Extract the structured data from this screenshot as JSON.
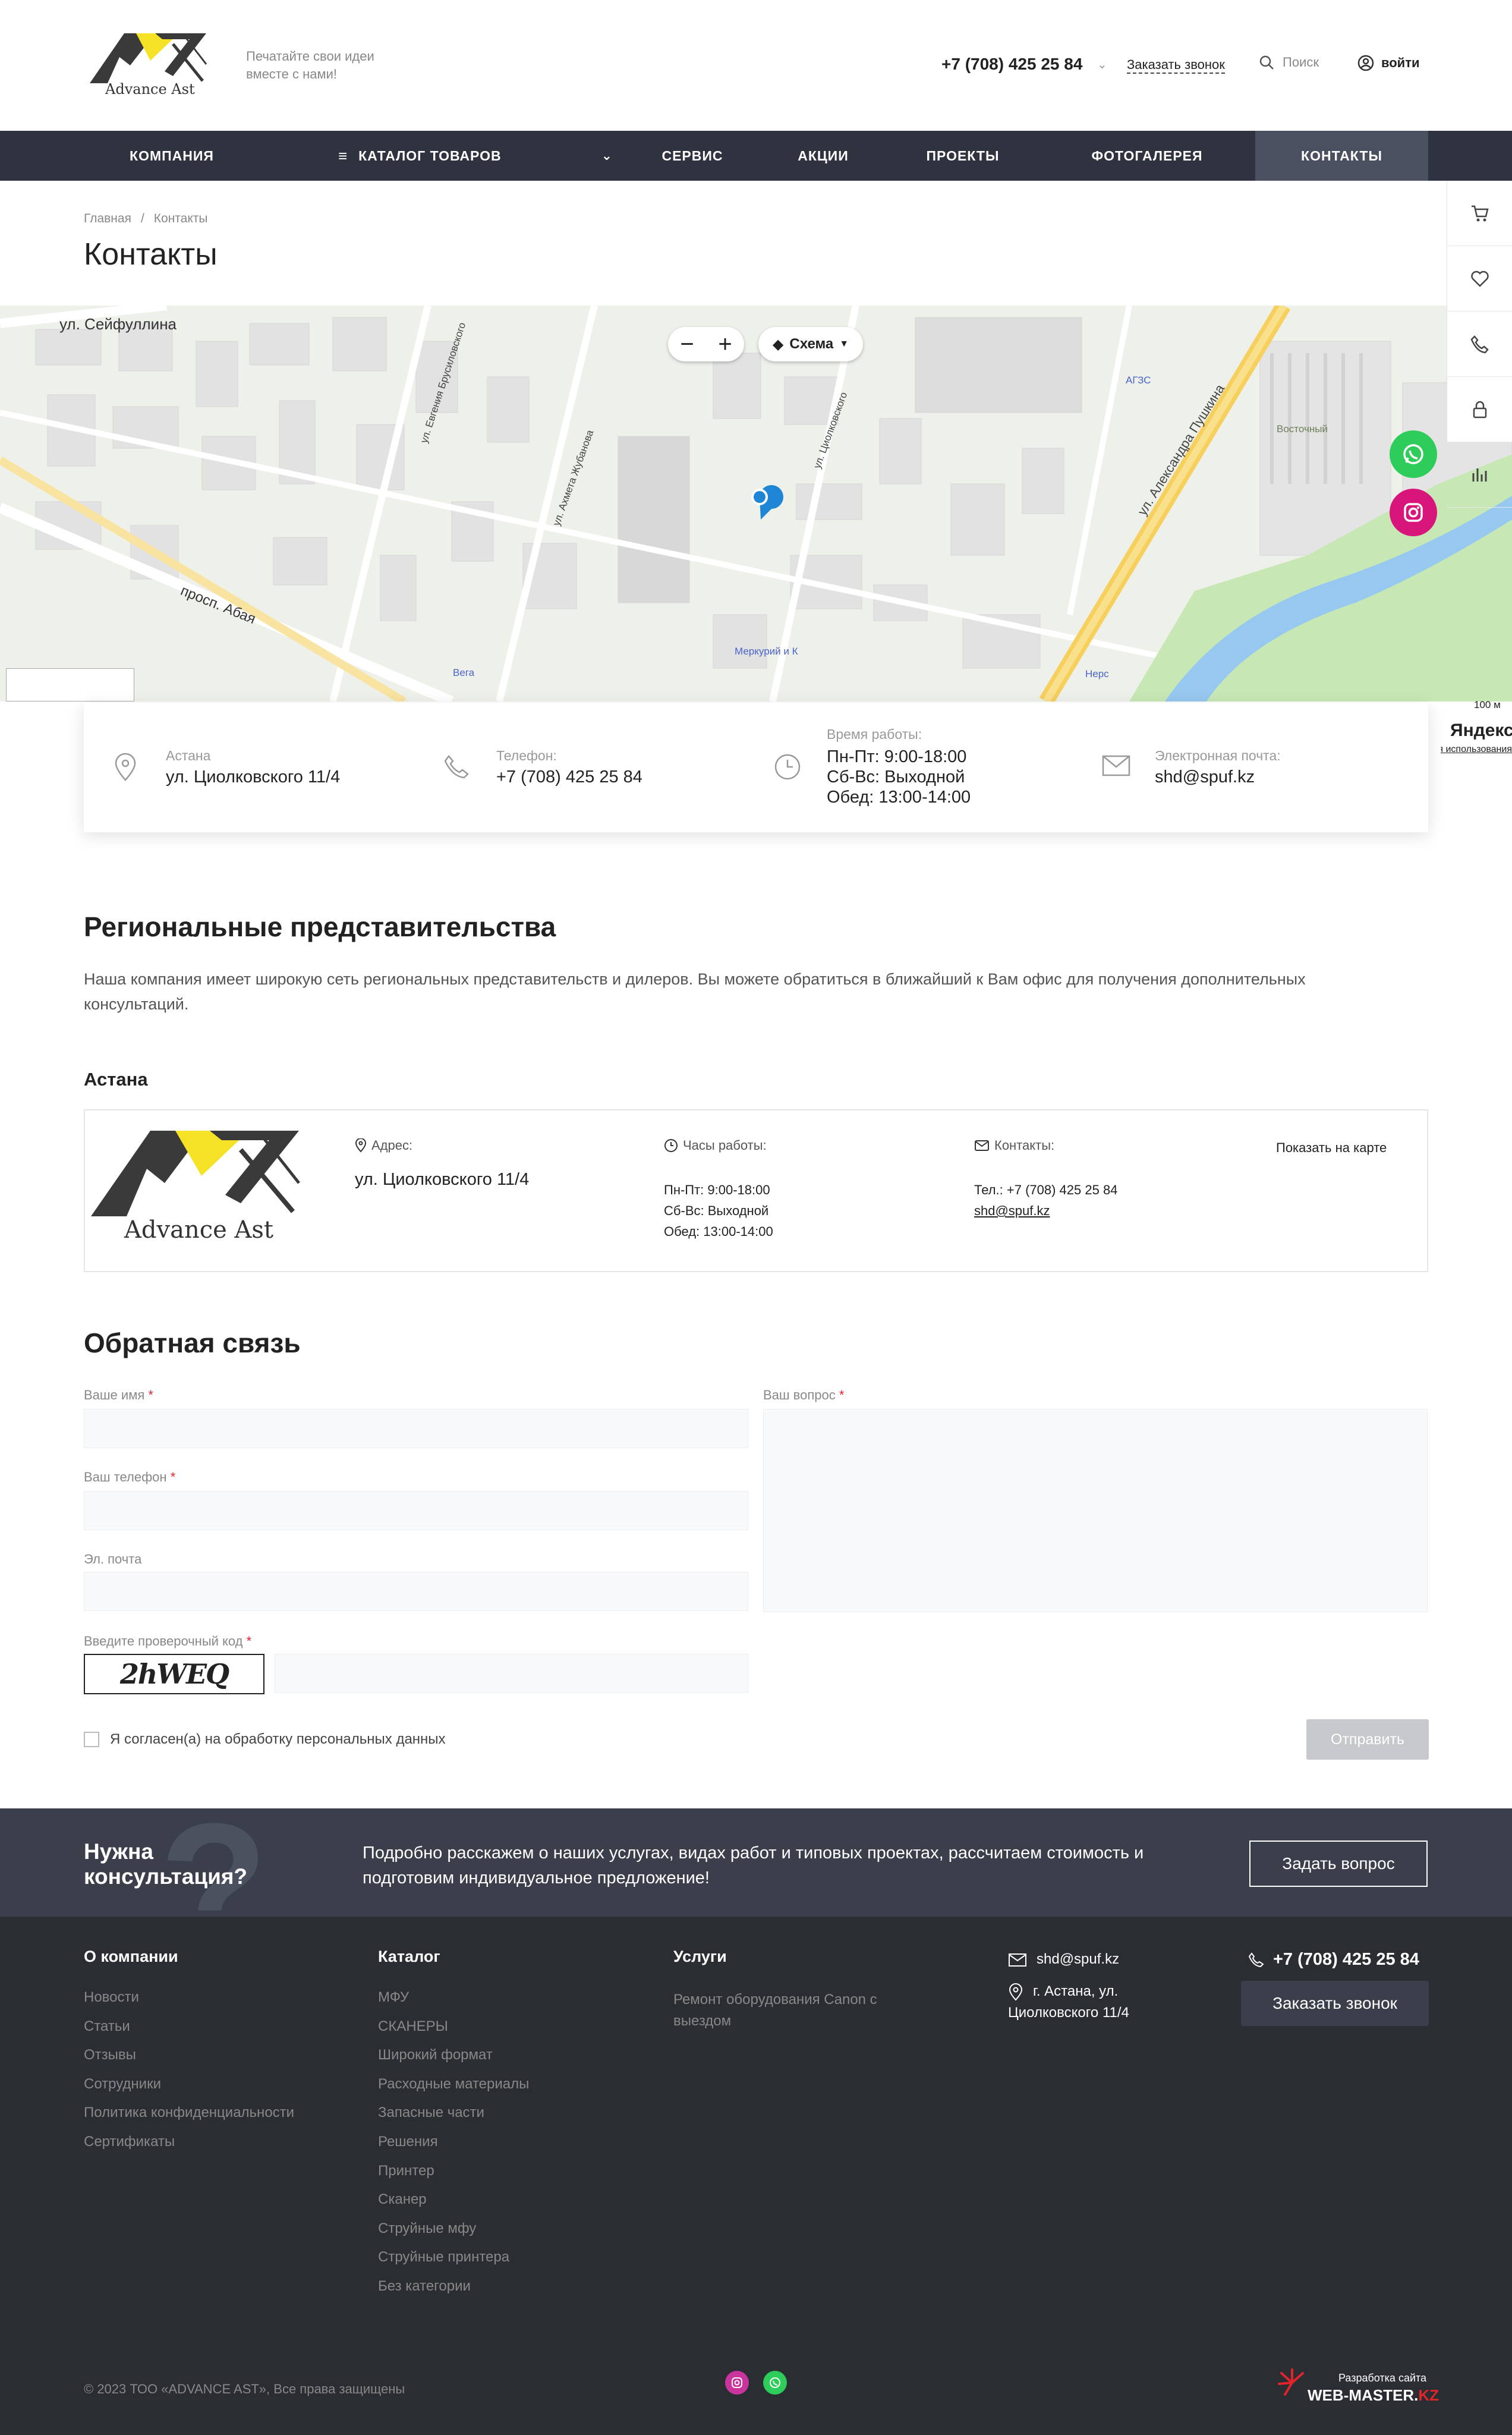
{
  "header": {
    "logo_text": "Advance Ast",
    "slogan": "Печатайте свои идеи вместе с нами!",
    "phone": "+7 (708) 425 25 84",
    "callback": "Заказать звонок",
    "search": "Поиск",
    "login": "войти"
  },
  "nav": {
    "items": [
      {
        "label": "КОМПАНИЯ"
      },
      {
        "label": "КАТАЛОГ ТОВАРОВ"
      },
      {
        "label": "СЕРВИС"
      },
      {
        "label": "АКЦИИ"
      },
      {
        "label": "ПРОЕКТЫ"
      },
      {
        "label": "ФОТОГАЛЕРЕЯ"
      },
      {
        "label": "КОНТАКТЫ"
      }
    ],
    "active": "КОНТАКТЫ"
  },
  "breadcrumb": {
    "home": "Главная",
    "separator": "/",
    "current": "Контакты"
  },
  "page_title": "Контакты",
  "map": {
    "zoom_out": "−",
    "zoom_in": "+",
    "layers": "Схема",
    "scale": "100 м",
    "provider": "Яндекс",
    "terms": "Условия использования",
    "labels": [
      {
        "text": "ул. Сейфуллина"
      },
      {
        "text": "просп. Абая"
      },
      {
        "text": "ул. Циолковского"
      },
      {
        "text": "ул. Александра Пушкина"
      },
      {
        "text": "ул. Ахмета Жубанова"
      },
      {
        "text": "ул. Евгения Брусиловского"
      },
      {
        "text": "Восточный"
      }
    ],
    "pois": [
      {
        "text": "Меркурий и К"
      },
      {
        "text": "Вега"
      },
      {
        "text": "АГЗС"
      },
      {
        "text": "Нерс"
      }
    ]
  },
  "contact_info": {
    "city_label": "Астана",
    "address": "ул. Циолковского 11/4",
    "phone_label": "Телефон:",
    "phone": "+7 (708) 425 25 84",
    "hours_label": "Время работы:",
    "hours": [
      "Пн-Пт: 9:00-18:00",
      "Сб-Вс: Выходной",
      "Обед: 13:00-14:00"
    ],
    "email_label": "Электронная почта:",
    "email": "shd@spuf.kz"
  },
  "regional": {
    "title": "Региональные представительства",
    "text": "Наша компания имеет широкую сеть региональных представительств и дилеров. Вы можете обратиться в ближайший к Вам офис для получения дополнительных консультаций.",
    "city": "Астана",
    "office": {
      "address_label": "Адрес:",
      "address": "ул. Циолковского 11/4",
      "hours_label": "Часы работы:",
      "hours": [
        "Пн-Пт: 9:00-18:00",
        "Сб-Вс: Выходной",
        "Обед: 13:00-14:00"
      ],
      "contacts_label": "Контакты:",
      "phone": "Тел.: +7 (708) 425 25 84",
      "email": "shd@spuf.kz",
      "show_on_map": "Показать на карте"
    }
  },
  "feedback": {
    "title": "Обратная связь",
    "name_label": "Ваше имя",
    "phone_label": "Ваш телефон",
    "email_label": "Эл. почта",
    "captcha_label": "Введите проверочный код",
    "captcha_code": "2hWEQ",
    "question_label": "Ваш вопрос",
    "required_mark": "*",
    "consent": "Я согласен(а) на обработку персональных данных",
    "submit": "Отправить"
  },
  "consult": {
    "title": "Нужна консультация?",
    "text": "Подробно расскажем о наших услугах, видах работ и типовых проектах, рассчитаем стоимость и подготовим индивидуальное предложение!",
    "button": "Задать вопрос"
  },
  "footer": {
    "about_title": "О компании",
    "about_links": [
      "Новости",
      "Статьи",
      "Отзывы",
      "Сотрудники",
      "Политика конфиденциальности",
      "Сертификаты"
    ],
    "catalog_title": "Каталог",
    "catalog_links": [
      "МФУ",
      "СКАНЕРЫ",
      "Широкий формат",
      "Расходные материалы",
      "Запасные части",
      "Решения",
      "Принтер",
      "Сканер",
      "Струйные мфу",
      "Струйные принтера",
      "Без категории"
    ],
    "services_title": "Услуги",
    "services_links": [
      "Ремонт оборудования Canon с выездом"
    ],
    "email": "shd@spuf.kz",
    "address": "г. Астана, ул. Циолковского 11/4",
    "phone": "+7 (708) 425 25 84",
    "callback": "Заказать звонок",
    "copyright": "© 2023 ТОО «ADVANCE AST», Все права защищены",
    "dev_small": "Разработка сайта",
    "dev_brand": "WEB-MASTER.",
    "dev_brand_suffix": "KZ"
  },
  "colors": {
    "nav_bg": "#2f3340",
    "nav_active": "#4a505f",
    "footer_bg": "#2a2d32",
    "consult_bg": "#3b3f4c",
    "whatsapp": "#2ecc5a",
    "instagram": "#d8157b",
    "logo_yellow": "#f5e227"
  }
}
